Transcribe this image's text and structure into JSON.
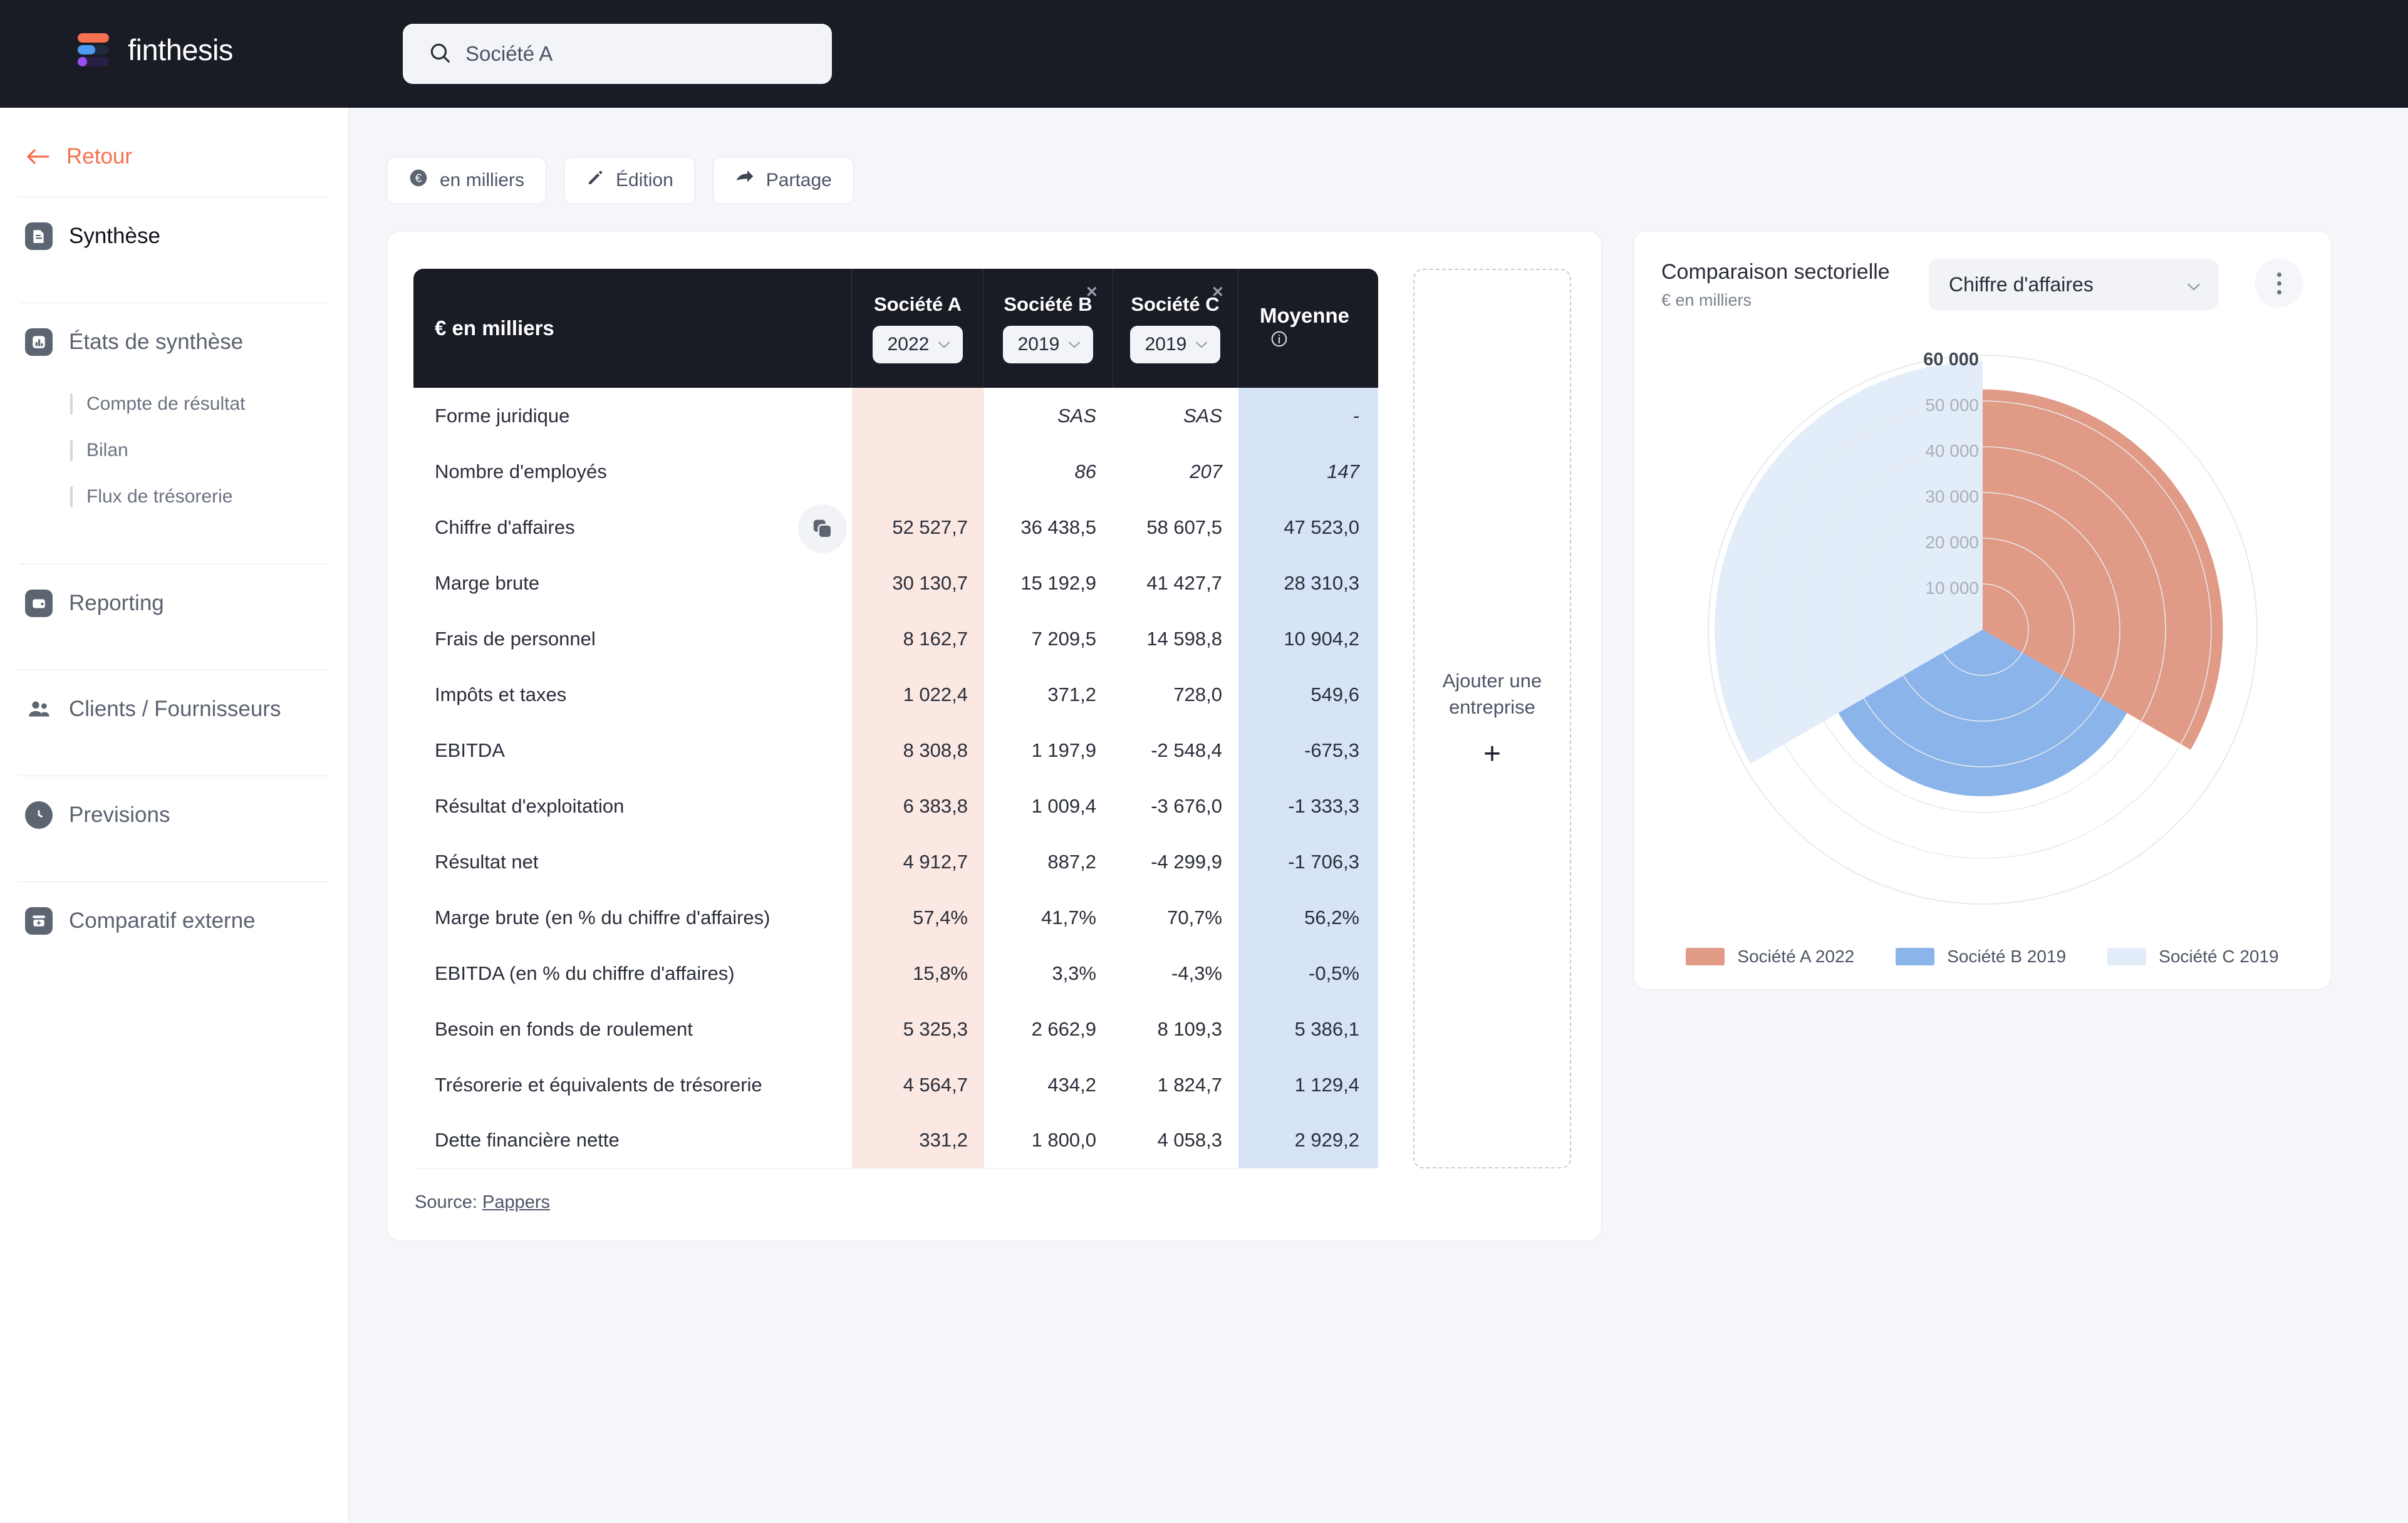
{
  "brand": {
    "name": "finthesis"
  },
  "search": {
    "value": "Société A",
    "icon": "search-icon"
  },
  "sidebar": {
    "back_label": "Retour",
    "items": [
      {
        "label": "Synthèse",
        "icon": "document-icon",
        "active": true
      },
      {
        "label": "États de synthèse",
        "icon": "bar-chart-icon",
        "active": false
      },
      {
        "label": "Reporting",
        "icon": "wallet-icon",
        "active": false
      },
      {
        "label": "Clients / Fournisseurs",
        "icon": "users-icon",
        "active": false
      },
      {
        "label": "Previsions",
        "icon": "clock-icon",
        "active": false
      },
      {
        "label": "Comparatif externe",
        "icon": "archive-icon",
        "active": false
      }
    ],
    "subitems": [
      {
        "label": "Compte de résultat"
      },
      {
        "label": "Bilan"
      },
      {
        "label": "Flux de trésorerie"
      }
    ]
  },
  "toolbar": {
    "buttons": [
      {
        "label": "en milliers",
        "icon": "euro-circle-icon"
      },
      {
        "label": "Édition",
        "icon": "pencil-icon"
      },
      {
        "label": "Partage",
        "icon": "share-icon"
      }
    ]
  },
  "table": {
    "copy_icon": "copy-icon",
    "corner_label": "€ en milliers",
    "mean_label": "Moyenne",
    "mean_info_icon": "info-icon",
    "companies": [
      {
        "name": "Société A",
        "year": "2022",
        "removable": false
      },
      {
        "name": "Société B",
        "year": "2019",
        "removable": true
      },
      {
        "name": "Société C",
        "year": "2019",
        "removable": true
      }
    ],
    "rows": [
      {
        "label": "Forme juridique",
        "a": "",
        "b": "SAS",
        "c": "SAS",
        "m": "-",
        "italic": true
      },
      {
        "label": "Nombre d'employés",
        "a": "",
        "b": "86",
        "c": "207",
        "m": "147",
        "italic": true
      },
      {
        "label": "Chiffre d'affaires",
        "a": "52 527,7",
        "b": "36 438,5",
        "c": "58 607,5",
        "m": "47 523,0",
        "italic": false
      },
      {
        "label": "Marge brute",
        "a": "30 130,7",
        "b": "15 192,9",
        "c": "41 427,7",
        "m": "28 310,3",
        "italic": false
      },
      {
        "label": "Frais de personnel",
        "a": "8 162,7",
        "b": "7 209,5",
        "c": "14 598,8",
        "m": "10 904,2",
        "italic": false
      },
      {
        "label": "Impôts et taxes",
        "a": "1 022,4",
        "b": "371,2",
        "c": "728,0",
        "m": "549,6",
        "italic": false
      },
      {
        "label": "EBITDA",
        "a": "8 308,8",
        "b": "1 197,9",
        "c": "-2 548,4",
        "m": "-675,3",
        "italic": false
      },
      {
        "label": "Résultat d'exploitation",
        "a": "6 383,8",
        "b": "1 009,4",
        "c": "-3 676,0",
        "m": "-1 333,3",
        "italic": false
      },
      {
        "label": "Résultat net",
        "a": "4 912,7",
        "b": "887,2",
        "c": "-4 299,9",
        "m": "-1 706,3",
        "italic": false
      },
      {
        "label": "Marge brute (en % du chiffre d'affaires)",
        "a": "57,4%",
        "b": "41,7%",
        "c": "70,7%",
        "m": "56,2%",
        "italic": false
      },
      {
        "label": "EBITDA (en % du chiffre d'affaires)",
        "a": "15,8%",
        "b": "3,3%",
        "c": "-4,3%",
        "m": "-0,5%",
        "italic": false
      },
      {
        "label": "Besoin en fonds de roulement",
        "a": "5 325,3",
        "b": "2 662,9",
        "c": "8 109,3",
        "m": "5 386,1",
        "italic": false
      },
      {
        "label": "Trésorerie et équivalents de trésorerie",
        "a": "4 564,7",
        "b": "434,2",
        "c": "1 824,7",
        "m": "1 129,4",
        "italic": false
      },
      {
        "label": "Dette financière nette",
        "a": "331,2",
        "b": "1 800,0",
        "c": "4 058,3",
        "m": "2 929,2",
        "italic": false
      }
    ],
    "add_company_label": "Ajouter une entreprise",
    "add_icon": "plus-icon",
    "source_prefix": "Source:",
    "source_link": "Pappers"
  },
  "chart_panel": {
    "title": "Comparaison sectorielle",
    "subtitle": "€ en milliers",
    "metric_selected": "Chiffre d'affaires",
    "chevron_icon": "chevron-down-icon",
    "menu_icon": "more-vertical-icon"
  },
  "chart_data": {
    "type": "pie",
    "variant": "polar-rose",
    "title": "Comparaison sectorielle",
    "subtitle": "€ en milliers",
    "metric": "Chiffre d'affaires",
    "unit": "€ en milliers",
    "radial_ticks": [
      "10 000",
      "20 000",
      "30 000",
      "40 000",
      "50 000",
      "60 000"
    ],
    "rlim": [
      0,
      60000
    ],
    "sector_span_deg": 120,
    "start_angle_deg": 0,
    "grid": true,
    "legend_position": "bottom",
    "series": [
      {
        "name": "Société A 2022",
        "value": 52527.7,
        "color": "#e09a85",
        "start_deg": 0,
        "end_deg": 120
      },
      {
        "name": "Société B 2019",
        "value": 36438.5,
        "color": "#8ab4ea",
        "start_deg": 120,
        "end_deg": 240
      },
      {
        "name": "Société C 2019",
        "value": 58607.5,
        "color": "#e2edf9",
        "start_deg": 240,
        "end_deg": 360
      }
    ],
    "legend": [
      "Société A 2022",
      "Société B 2019",
      "Société C 2019"
    ]
  }
}
